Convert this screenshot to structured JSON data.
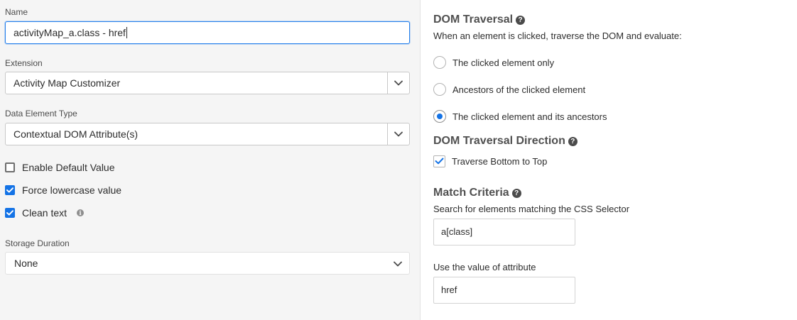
{
  "left": {
    "name": {
      "label": "Name",
      "value": "activityMap_a.class - href"
    },
    "extension": {
      "label": "Extension",
      "value": "Activity Map Customizer"
    },
    "data_element_type": {
      "label": "Data Element Type",
      "value": "Contextual DOM Attribute(s)"
    },
    "options": [
      {
        "label": "Enable Default Value",
        "checked": false
      },
      {
        "label": "Force lowercase value",
        "checked": true
      },
      {
        "label": "Clean text",
        "checked": true
      }
    ],
    "storage_duration": {
      "label": "Storage Duration",
      "value": "None"
    }
  },
  "right": {
    "dom_traversal": {
      "heading": "DOM Traversal",
      "description": "When an element is clicked, traverse the DOM and evaluate:",
      "options": [
        {
          "label": "The clicked element only",
          "selected": false
        },
        {
          "label": "Ancestors of the clicked element",
          "selected": false
        },
        {
          "label": "The clicked element and its ancestors",
          "selected": true
        }
      ]
    },
    "dom_traversal_direction": {
      "heading": "DOM Traversal Direction",
      "checkbox_label": "Traverse Bottom to Top",
      "checked": true
    },
    "match_criteria": {
      "heading": "Match Criteria",
      "selector_label": "Search for elements matching the CSS Selector",
      "selector_value": "a[class]",
      "attribute_label": "Use the value of attribute",
      "attribute_value": "href"
    }
  },
  "colors": {
    "accent": "#1473e6",
    "focus_border": "#2680eb",
    "left_panel_bg": "#f5f5f5"
  }
}
